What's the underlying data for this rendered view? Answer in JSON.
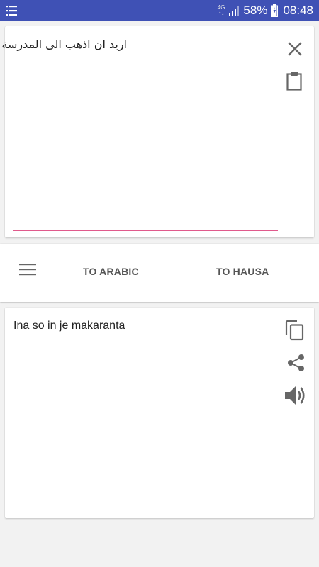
{
  "status_bar": {
    "network_type": [
      "4G",
      "↑↓"
    ],
    "battery_percent": "58%",
    "time": "08:48",
    "icons": [
      "list-icon",
      "signal-icon",
      "battery-icon"
    ]
  },
  "input_card": {
    "source_text": "اريد ان اذهب الى المدرسة",
    "underline_color": "#e05a8c",
    "icons": [
      "close-icon",
      "clipboard-icon"
    ]
  },
  "toolbar": {
    "to_arabic_label": "TO ARABIC",
    "to_hausa_label": "TO HAUSA",
    "icons": [
      "menu-icon"
    ]
  },
  "output_card": {
    "translated_text": "Ina so in je makaranta",
    "icons": [
      "copy-icon",
      "share-icon",
      "volume-icon"
    ]
  },
  "colors": {
    "status_bar": "#3f51b5",
    "accent": "#e05a8c",
    "background": "#f2f2f2"
  }
}
